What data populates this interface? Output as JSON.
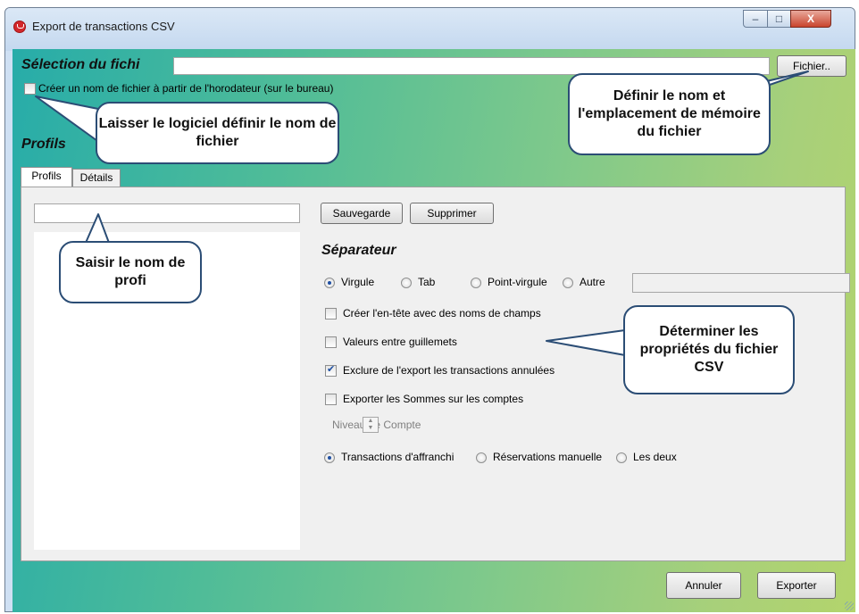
{
  "window": {
    "title": "Export de transactions CSV",
    "controls": {
      "minimize": "–",
      "maximize": "□",
      "close": "X"
    }
  },
  "file": {
    "label": "Sélection du fichi",
    "value": "",
    "button": "Fichier..",
    "timestamp_checkbox": {
      "label": "Créer un nom de fichier à partir de l'horodateur (sur le bureau)",
      "checked": false
    }
  },
  "profiles": {
    "label": "Profils",
    "tabs": [
      {
        "label": "Profils",
        "active": true
      },
      {
        "label": "Détails",
        "active": false
      }
    ],
    "name_input": "",
    "save_button": "Sauvegarde",
    "delete_button": "Supprimer"
  },
  "separator": {
    "label": "Séparateur",
    "options": [
      {
        "label": "Virgule",
        "checked": true
      },
      {
        "label": "Tab",
        "checked": false
      },
      {
        "label": "Point-virgule",
        "checked": false
      },
      {
        "label": "Autre",
        "checked": false
      }
    ],
    "other_value": ""
  },
  "options": [
    {
      "label": "Créer l'en-tête avec des noms de champs",
      "checked": false
    },
    {
      "label": "Valeurs entre guillemets",
      "checked": false
    },
    {
      "label": "Exclure de l'export les transactions annulées",
      "checked": true
    },
    {
      "label": "Exporter les Sommes sur les comptes",
      "checked": false
    }
  ],
  "account_level": {
    "label": "Niveau de Compte",
    "value": ""
  },
  "transaction_type": [
    {
      "label": "Transactions d'affranchi",
      "checked": true
    },
    {
      "label": "Réservations manuelle",
      "checked": false
    },
    {
      "label": "Les deux",
      "checked": false
    }
  ],
  "footer": {
    "cancel": "Annuler",
    "export": "Exporter"
  },
  "callouts": {
    "filename": "Laisser le logiciel définir le nom de fichier",
    "location": "Définir le nom et l'emplacement de mémoire du fichier",
    "profile": "Saisir le nom de profi",
    "csv": "Déterminer les propriétés du fichier CSV"
  }
}
